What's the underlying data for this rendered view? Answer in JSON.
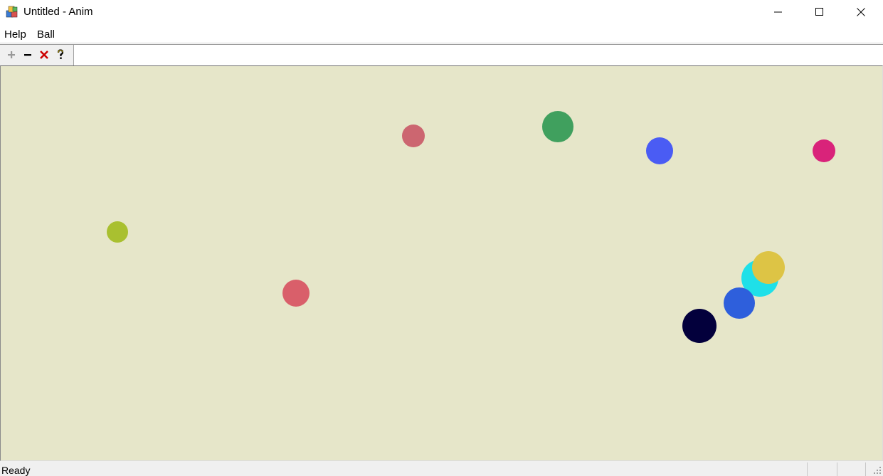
{
  "window": {
    "title": "Untitled - Anim",
    "icon": "app-icon",
    "controls": [
      "minimize-icon",
      "maximize-icon",
      "close-icon"
    ]
  },
  "menu": {
    "items": [
      {
        "label": "Help"
      },
      {
        "label": "Ball"
      }
    ]
  },
  "toolbar": {
    "buttons": [
      {
        "icon": "plus-icon",
        "color": "#9a9a9a"
      },
      {
        "icon": "minus-icon",
        "color": "#000000"
      },
      {
        "icon": "delete-icon",
        "color": "#cc0000"
      },
      {
        "icon": "help-icon",
        "color": "#000000"
      }
    ]
  },
  "canvas": {
    "background": "#e6e6c9",
    "balls": [
      {
        "color": "#cc6670"
      },
      {
        "color": "#40a05e"
      },
      {
        "color": "#4a5cf4"
      },
      {
        "color": "#d9237a"
      },
      {
        "color": "#a9c030"
      },
      {
        "color": "#d95f6a"
      },
      {
        "color": "#1fe0e8"
      },
      {
        "color": "#ddc445"
      },
      {
        "color": "#2e5fdc"
      },
      {
        "color": "#03003c"
      }
    ]
  },
  "status": {
    "text": "Ready"
  }
}
